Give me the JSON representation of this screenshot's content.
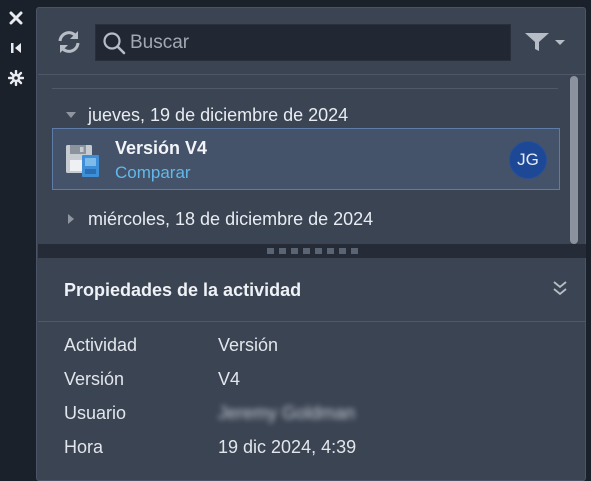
{
  "toolstrip": {
    "items": [
      {
        "name": "close-icon"
      },
      {
        "name": "collapse-panel-icon"
      },
      {
        "name": "settings-icon"
      }
    ]
  },
  "toolbar": {
    "refresh_icon": "refresh-icon",
    "search": {
      "placeholder": "Buscar",
      "value": ""
    },
    "filter_icon": "filter-icon"
  },
  "activity": {
    "groups": [
      {
        "date": "jueves, 19 de diciembre de 2024",
        "expanded": true
      },
      {
        "date": "miércoles, 18 de diciembre de 2024",
        "expanded": false
      }
    ],
    "selected_item": {
      "title": "Versión V4",
      "action": "Comparar",
      "user_initials": "JG",
      "avatar_color": "#1d4896"
    }
  },
  "properties": {
    "title": "Propiedades de la actividad",
    "rows": [
      {
        "key": "Actividad",
        "value": "Versión"
      },
      {
        "key": "Versión",
        "value": "V4"
      },
      {
        "key": "Usuario",
        "value": "Jeremy Goldman"
      },
      {
        "key": "Hora",
        "value": "19 dic 2024, 4:39"
      }
    ]
  },
  "colors": {
    "accent": "#62b8ea",
    "selection_border": "#5d7da8",
    "panel_bg": "#3b4453"
  }
}
